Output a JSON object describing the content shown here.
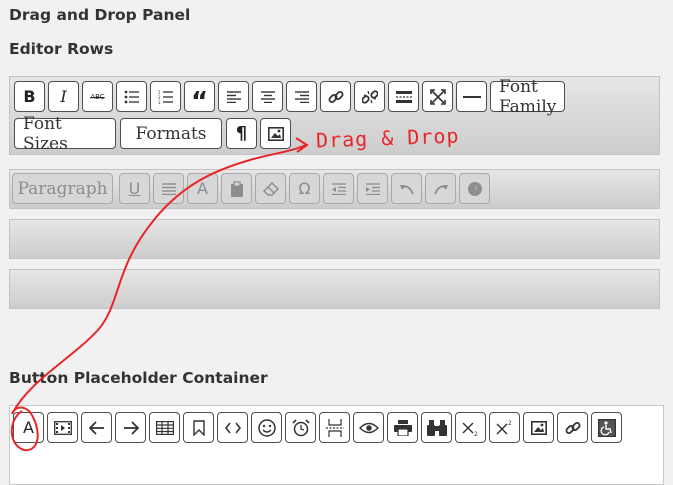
{
  "panel_title": "Drag and Drop Panel",
  "editor_rows_title": "Editor Rows",
  "placeholder_title": "Button Placeholder Container",
  "annotation": "Drag & Drop",
  "row1": {
    "buttons": [
      {
        "name": "bold-button",
        "icon": "bold",
        "label": "B"
      },
      {
        "name": "italic-button",
        "icon": "italic",
        "label": "I"
      },
      {
        "name": "strikethrough-button",
        "icon": "strikethrough",
        "label": "ABC"
      },
      {
        "name": "bullet-list-button",
        "icon": "bullet-list"
      },
      {
        "name": "numbered-list-button",
        "icon": "numbered-list"
      },
      {
        "name": "blockquote-button",
        "icon": "blockquote",
        "label": "“"
      },
      {
        "name": "align-left-button",
        "icon": "align-left"
      },
      {
        "name": "align-center-button",
        "icon": "align-center"
      },
      {
        "name": "align-right-button",
        "icon": "align-right"
      },
      {
        "name": "insert-link-button",
        "icon": "link"
      },
      {
        "name": "remove-link-button",
        "icon": "unlink"
      },
      {
        "name": "read-more-button",
        "icon": "read-more"
      },
      {
        "name": "fullscreen-button",
        "icon": "fullscreen"
      },
      {
        "name": "horizontal-rule-button",
        "icon": "horizontal-rule"
      }
    ],
    "font_family_label": "Font Family",
    "font_sizes_label": "Font Sizes",
    "formats_label": "Formats",
    "paragraph_mark_label": "¶"
  },
  "row2": {
    "paragraph_label": "Paragraph",
    "underline_label": "U",
    "text_color_label": "A",
    "special_char_label": "Ω"
  },
  "placeholder_buttons": [
    {
      "name": "text-color-button",
      "label": "A"
    },
    {
      "name": "media-button",
      "icon": "film"
    },
    {
      "name": "undo-arrow-button",
      "icon": "arrow-left"
    },
    {
      "name": "redo-arrow-button",
      "icon": "arrow-right"
    },
    {
      "name": "table-button",
      "icon": "table"
    },
    {
      "name": "anchor-button",
      "icon": "bookmark"
    },
    {
      "name": "code-button",
      "icon": "code"
    },
    {
      "name": "emoticons-button",
      "icon": "smiley"
    },
    {
      "name": "datetime-button",
      "icon": "alarm-clock"
    },
    {
      "name": "page-break-button",
      "icon": "page-break"
    },
    {
      "name": "preview-button",
      "icon": "eye"
    },
    {
      "name": "print-button",
      "icon": "printer"
    },
    {
      "name": "find-button",
      "icon": "binoculars"
    },
    {
      "name": "subscript-button",
      "icon": "subscript"
    },
    {
      "name": "superscript-button",
      "icon": "superscript"
    },
    {
      "name": "image-button",
      "icon": "image"
    },
    {
      "name": "link-button",
      "icon": "link"
    },
    {
      "name": "accessibility-button",
      "icon": "wheelchair"
    }
  ],
  "colors": {
    "annotation": "#e8262a",
    "background": "#f1f1f1",
    "border": "#4f4f4f"
  }
}
